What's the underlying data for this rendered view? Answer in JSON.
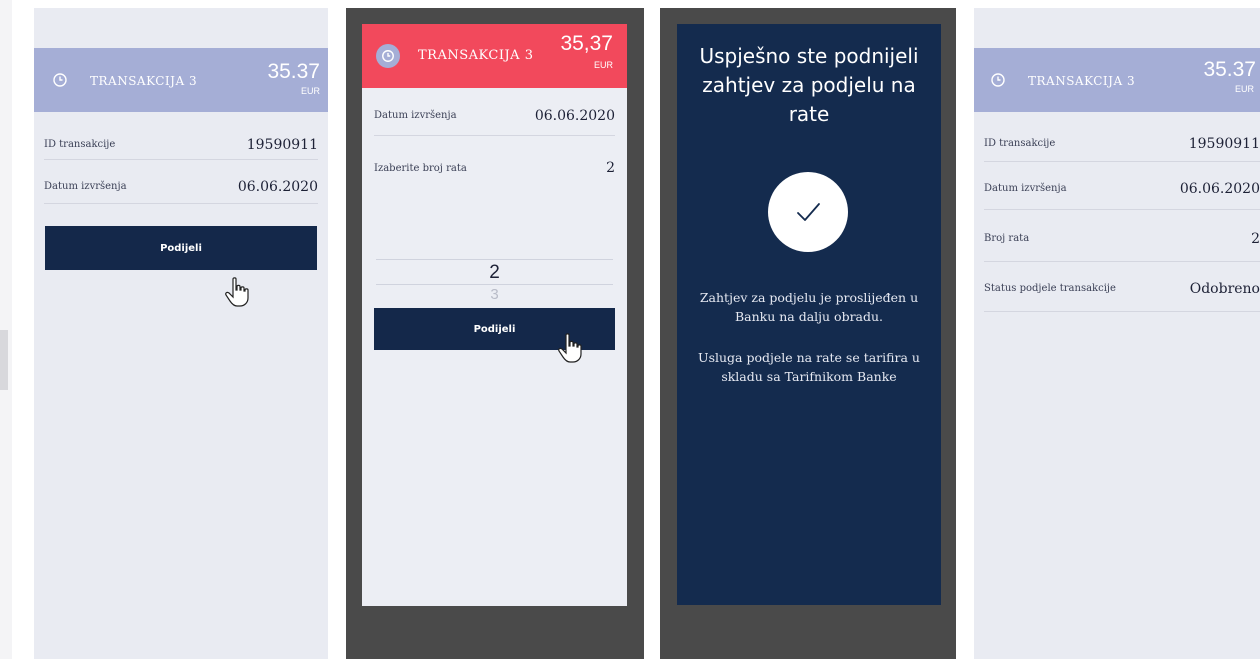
{
  "panel1": {
    "title": "TRANSAKCIJA 3",
    "amount": "35.37",
    "currency": "EUR",
    "rows": [
      {
        "label": "ID transakcije",
        "value": "19590911"
      },
      {
        "label": "Datum izvršenja",
        "value": "06.06.2020"
      }
    ],
    "button_label": "Podijeli",
    "icon": "clock-icon",
    "header_color": "#a5aed6"
  },
  "panel2": {
    "title": "TRANSAKCIJA 3",
    "amount": "35,37",
    "currency": "EUR",
    "rows": [
      {
        "label": "Datum izvršenja",
        "value": "06.06.2020"
      },
      {
        "label": "Izaberite broj rata",
        "value": "2"
      }
    ],
    "picker": {
      "selected": "2",
      "next": "3"
    },
    "button_label": "Podijeli",
    "icon": "clock-icon",
    "header_color": "#f2495c"
  },
  "panel3": {
    "title": "Uspješno ste podnijeli zahtjev za podjelu na rate",
    "message1": "Zahtjev za podjelu je proslijeđen u Banku na dalju obradu.",
    "message2": "Usluga podjele na rate se tarifira u skladu sa Tarifnikom Banke",
    "icon": "checkmark-icon",
    "background_color": "#142b4e"
  },
  "panel4": {
    "title": "TRANSAKCIJA 3",
    "amount": "35.37",
    "currency": "EUR",
    "rows": [
      {
        "label": "ID transakcije",
        "value": "19590911"
      },
      {
        "label": "Datum izvršenja",
        "value": "06.06.2020"
      },
      {
        "label": "Broj rata",
        "value": "2"
      },
      {
        "label": "Status podjele transakcije",
        "value": "Odobreno"
      }
    ],
    "icon": "clock-icon"
  }
}
